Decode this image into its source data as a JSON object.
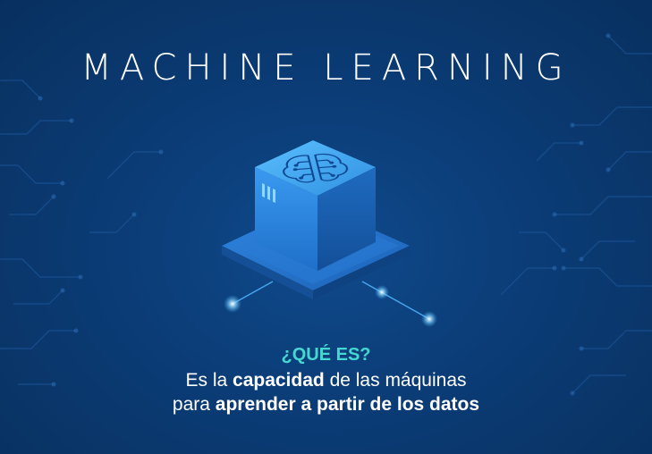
{
  "title": "MACHINE LEARNING",
  "hero": {
    "icon": "brain-cube-icon",
    "accent_color": "#3aa8f0"
  },
  "question": "¿QUÉ ES?",
  "description": {
    "line1": {
      "part1": "Es la ",
      "bold1": "capacidad",
      "part2": " de las máquinas"
    },
    "line2": {
      "part1": "para ",
      "bold1": "aprender a partir de los datos"
    }
  },
  "colors": {
    "background": "#0a3a72",
    "question": "#47d7d2",
    "text": "#ffffff"
  }
}
